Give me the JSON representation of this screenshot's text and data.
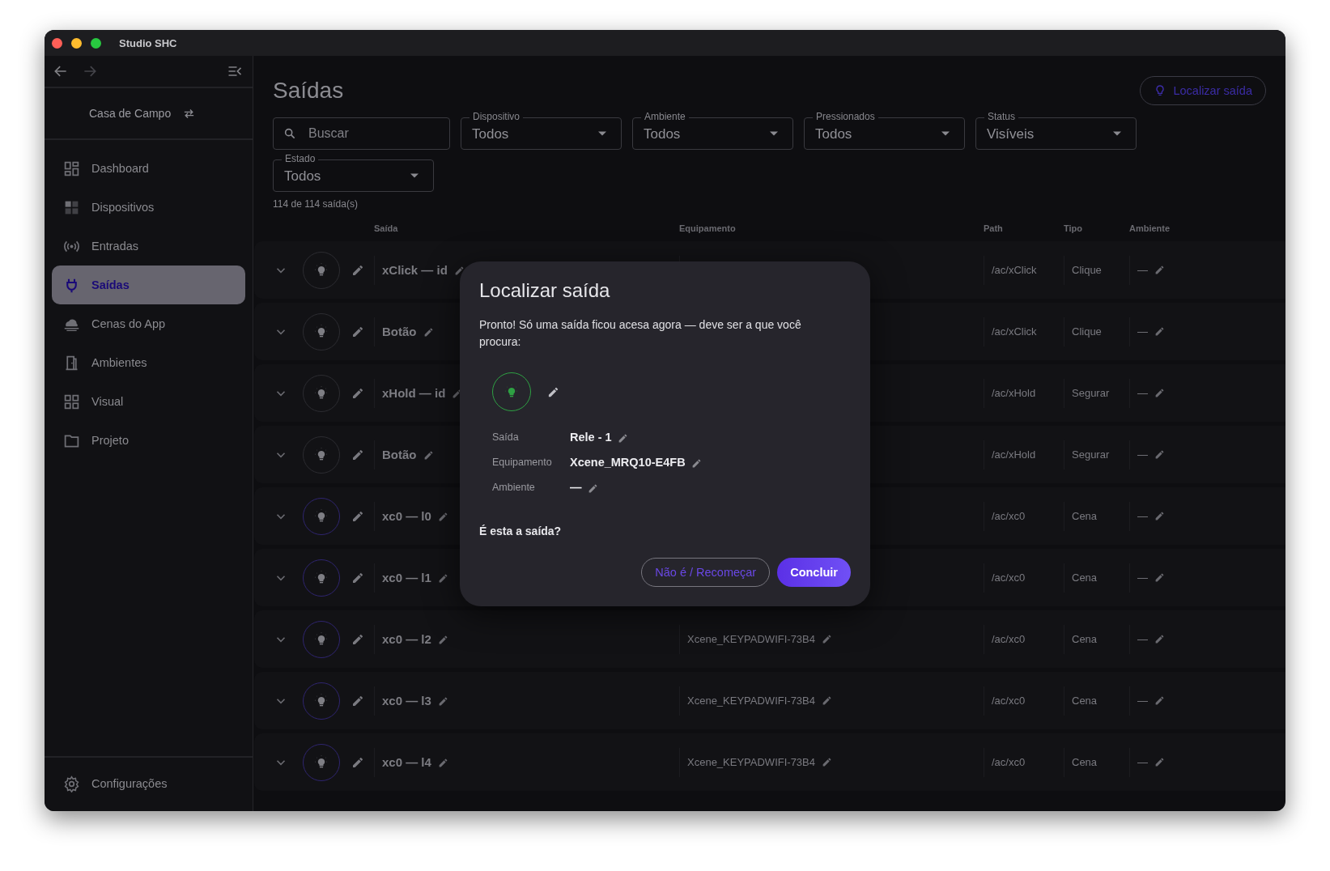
{
  "window": {
    "title": "Studio SHC"
  },
  "sidebar": {
    "project": "Casa de Campo",
    "items": [
      {
        "label": "Dashboard",
        "selected": false
      },
      {
        "label": "Dispositivos",
        "selected": false
      },
      {
        "label": "Entradas",
        "selected": false
      },
      {
        "label": "Saídas",
        "selected": true
      },
      {
        "label": "Cenas do App",
        "selected": false
      },
      {
        "label": "Ambientes",
        "selected": false
      },
      {
        "label": "Visual",
        "selected": false
      },
      {
        "label": "Projeto",
        "selected": false
      }
    ],
    "footer": {
      "label": "Configurações"
    }
  },
  "page": {
    "title": "Saídas",
    "action": "Localizar saída"
  },
  "search": {
    "placeholder": "Buscar"
  },
  "filters": [
    {
      "label": "Dispositivo",
      "value": "Todos"
    },
    {
      "label": "Ambiente",
      "value": "Todos"
    },
    {
      "label": "Pressionados",
      "value": "Todos"
    },
    {
      "label": "Status",
      "value": "Visíveis"
    },
    {
      "label": "Estado",
      "value": "Todos"
    }
  ],
  "count": "114 de 114 saída(s)",
  "table": {
    "columns": [
      "Saída",
      "Equipamento",
      "Path",
      "Tipo",
      "Ambiente"
    ],
    "rows": [
      {
        "name": "xClick — id",
        "path": "/ac/xClick",
        "type": "Clique",
        "room": "—",
        "active": false
      },
      {
        "name": "Botão",
        "path": "/ac/xClick",
        "type": "Clique",
        "room": "—",
        "active": false
      },
      {
        "name": "xHold — id",
        "path": "/ac/xHold",
        "type": "Segurar",
        "room": "—",
        "active": false
      },
      {
        "name": "Botão",
        "path": "/ac/xHold",
        "type": "Segurar",
        "room": "—",
        "active": false
      },
      {
        "name": "xc0 — l0",
        "path": "/ac/xc0",
        "type": "Cena",
        "room": "—",
        "active": true
      },
      {
        "name": "xc0 — l1",
        "path": "/ac/xc0",
        "type": "Cena",
        "room": "—",
        "active": true
      },
      {
        "name": "xc0 — l2",
        "equipment": "Xcene_KEYPADWIFI-73B4",
        "path": "/ac/xc0",
        "type": "Cena",
        "room": "—",
        "active": true
      },
      {
        "name": "xc0 — l3",
        "equipment": "Xcene_KEYPADWIFI-73B4",
        "path": "/ac/xc0",
        "type": "Cena",
        "room": "—",
        "active": true
      },
      {
        "name": "xc0 — l4",
        "equipment": "Xcene_KEYPADWIFI-73B4",
        "path": "/ac/xc0",
        "type": "Cena",
        "room": "—",
        "active": true
      }
    ]
  },
  "dialog": {
    "title": "Localizar saída",
    "message": "Pronto! Só uma saída ficou acesa agora — deve ser a que você procura:",
    "lamp": {
      "on": true
    },
    "details": [
      {
        "label": "Saída",
        "value": "Rele - 1"
      },
      {
        "label": "Equipamento",
        "value": "Xcene_MRQ10-E4FB"
      },
      {
        "label": "Ambiente",
        "value": "—"
      }
    ],
    "question": "É esta a saída?",
    "buttons": [
      {
        "label": "Não é / Recomeçar",
        "kind": "secondary"
      },
      {
        "label": "Concluir",
        "kind": "primary"
      }
    ]
  }
}
